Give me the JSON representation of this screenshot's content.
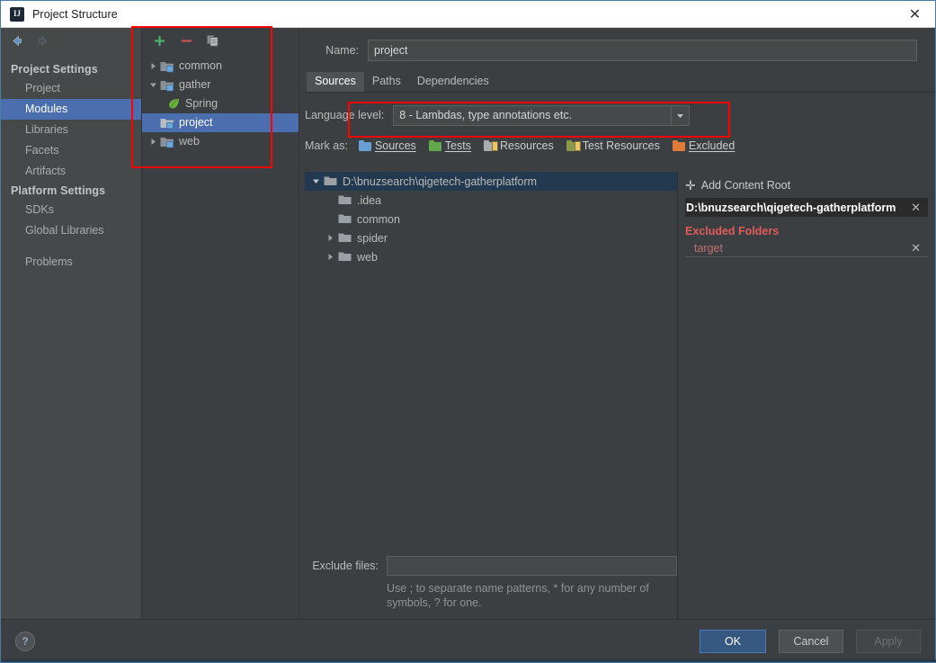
{
  "window": {
    "title": "Project Structure",
    "app_icon": "intellij-idea-icon",
    "close_label": "✕"
  },
  "nav": {
    "back_icon": "back-arrow-icon",
    "forward_icon": "forward-arrow-icon"
  },
  "sidebar": {
    "groups": [
      {
        "label": "Project Settings",
        "items": [
          {
            "label": "Project",
            "selected": false
          },
          {
            "label": "Modules",
            "selected": true
          },
          {
            "label": "Libraries",
            "selected": false
          },
          {
            "label": "Facets",
            "selected": false
          },
          {
            "label": "Artifacts",
            "selected": false
          }
        ]
      },
      {
        "label": "Platform Settings",
        "items": [
          {
            "label": "SDKs",
            "selected": false
          },
          {
            "label": "Global Libraries",
            "selected": false
          }
        ]
      }
    ],
    "problems": {
      "label": "Problems"
    }
  },
  "modules_panel": {
    "toolbar": {
      "add_label": "+",
      "remove_label": "−",
      "copy_label": "copy"
    },
    "tree": [
      {
        "label": "common",
        "arrow": "collapsed",
        "icon": "module-folder-icon",
        "indent": 0,
        "selected": false
      },
      {
        "label": "gather",
        "arrow": "expanded",
        "icon": "module-folder-icon",
        "indent": 0,
        "selected": false
      },
      {
        "label": "Spring",
        "arrow": "none",
        "icon": "spring-leaf-icon",
        "indent": 1,
        "selected": false
      },
      {
        "label": "project",
        "arrow": "none",
        "icon": "module-folder-icon",
        "indent": 0,
        "selected": true
      },
      {
        "label": "web",
        "arrow": "collapsed",
        "icon": "module-folder-icon",
        "indent": 0,
        "selected": false
      }
    ]
  },
  "content": {
    "name_label": "Name:",
    "name_value": "project",
    "name_placeholder": "",
    "tabs": [
      {
        "label": "Sources",
        "active": true
      },
      {
        "label": "Paths",
        "active": false
      },
      {
        "label": "Dependencies",
        "active": false
      }
    ],
    "language_level": {
      "label": "Language level:",
      "value": "8 - Lambdas, type annotations etc.",
      "arrow_icon": "chevron-down-icon"
    },
    "mark_as": {
      "label": "Mark as:",
      "options": [
        {
          "label": "Sources",
          "color": "#6a9fd4",
          "kind": "plain"
        },
        {
          "label": "Tests",
          "color": "#62a84b",
          "kind": "plain"
        },
        {
          "label": "Resources",
          "color": "#a9adb0",
          "kind": "lined"
        },
        {
          "label": "Test Resources",
          "color": "#8a9a4b",
          "kind": "lined"
        },
        {
          "label": "Excluded",
          "color": "#e07b39",
          "kind": "plain"
        }
      ]
    },
    "source_tree": [
      {
        "label": "D:\\bnuzsearch\\qigetech-gatherplatform",
        "arrow": "expanded",
        "indent": 0,
        "selected": true
      },
      {
        "label": ".idea",
        "arrow": "none",
        "indent": 1,
        "selected": false
      },
      {
        "label": "common",
        "arrow": "none",
        "indent": 1,
        "selected": false
      },
      {
        "label": "spider",
        "arrow": "collapsed",
        "indent": 1,
        "selected": false
      },
      {
        "label": "web",
        "arrow": "collapsed",
        "indent": 1,
        "selected": false
      }
    ],
    "exclude_files": {
      "label": "Exclude files:",
      "value": "",
      "placeholder": "",
      "hint": "Use ; to separate name patterns, * for any number of symbols, ? for one."
    }
  },
  "right_panel": {
    "add_content_root": "Add Content Root",
    "content_root": "D:\\bnuzsearch\\qigetech-gatherplatform",
    "content_root_remove": "✕",
    "excluded_folders_title": "Excluded Folders",
    "excluded_folders": [
      {
        "label": "target",
        "remove": "✕"
      }
    ]
  },
  "footer": {
    "help_label": "?",
    "ok_label": "OK",
    "cancel_label": "Cancel",
    "apply_label": "Apply"
  },
  "colors": {
    "accent_selection": "#4b6eaf",
    "tree_selection": "#22394f",
    "primary_button": "#365880",
    "excluded_red": "#e35b5b",
    "annotation_red": "#ff0000",
    "panel_bg": "#3c3f41",
    "sidebar_bg": "#45494a"
  }
}
